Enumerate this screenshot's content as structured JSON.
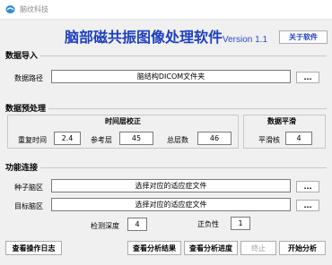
{
  "window": {
    "title": "脑纹科技"
  },
  "header": {
    "app_title": "脑部磁共振图像处理软件",
    "version": "Version 1.1",
    "about_label": "关于软件"
  },
  "data_import": {
    "title": "数据导入",
    "path_label": "数据路径",
    "path_value": "脑结构DICOM文件夹",
    "browse_label": "..."
  },
  "preprocess": {
    "title": "数据预处理",
    "timing": {
      "title": "时间层校正",
      "tr_label": "重复时间",
      "tr_value": "2.4",
      "ref_label": "参考层",
      "ref_value": "45",
      "total_label": "总层数",
      "total_value": "46"
    },
    "smooth": {
      "title": "数据平滑",
      "kernel_label": "平滑核",
      "kernel_value": "4"
    }
  },
  "connectivity": {
    "title": "功能连接",
    "seed_label": "种子脑区",
    "seed_value": "选择对应的适应症文件",
    "seed_browse": "...",
    "target_label": "目标脑区",
    "target_value": "选择对应的适应症文件",
    "target_browse": "...",
    "depth_label": "检测深度",
    "depth_value": "4",
    "neg_label": "正负性",
    "neg_value": "1"
  },
  "footer": {
    "log_label": "查看操作日志",
    "results_label": "查看分析结果",
    "progress_label": "查看分析进度",
    "stop_label": "终止",
    "start_label": "开始分析"
  }
}
